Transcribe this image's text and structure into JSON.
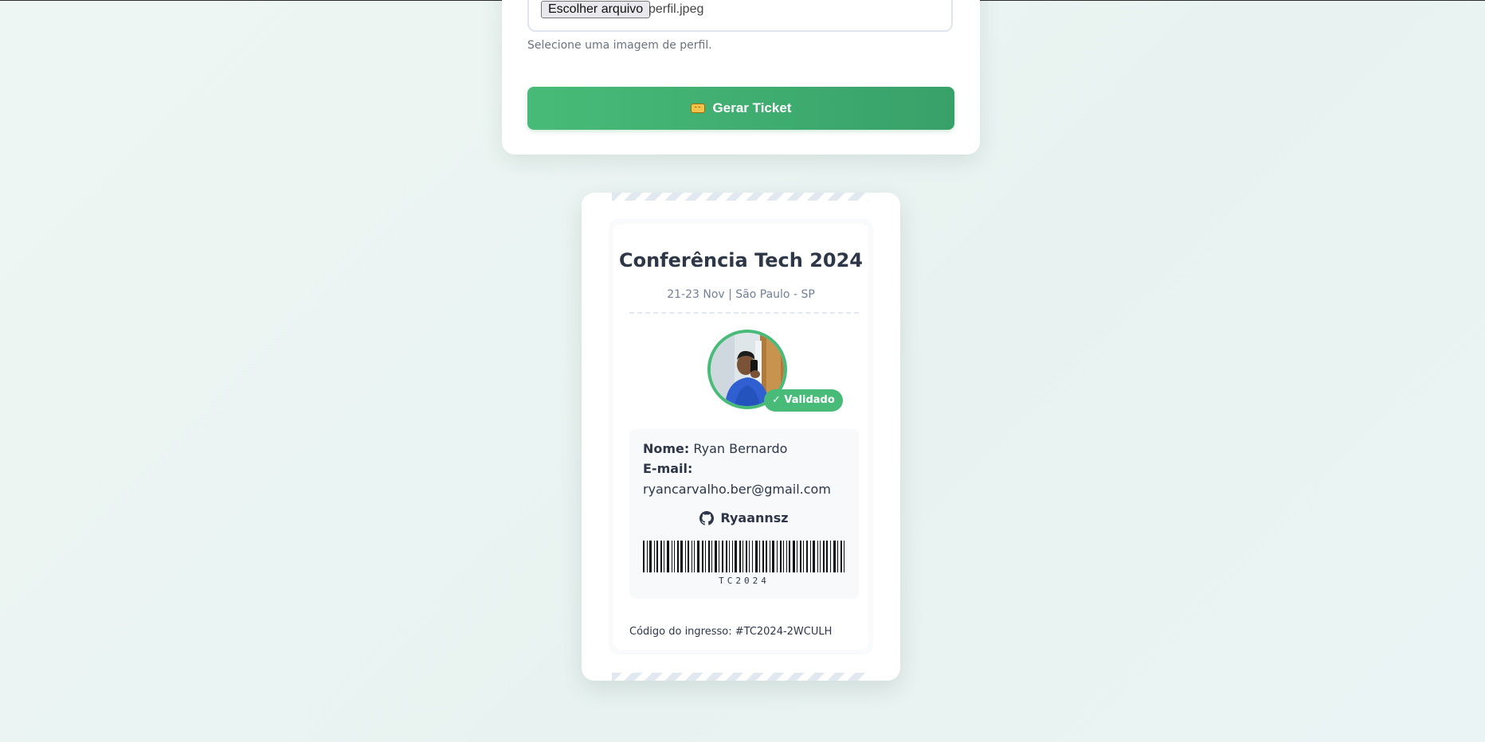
{
  "form": {
    "file_button_label": "Escolher arquivo",
    "file_name": "perfil.jpeg",
    "file_hint": "Selecione uma imagem de perfil.",
    "submit_label": "Gerar Ticket",
    "submit_icon": "ticket-icon"
  },
  "ticket": {
    "title": "Conferência Tech 2024",
    "subtitle": "21-23 Nov | São Paulo - SP",
    "badge": "✓ Validado",
    "name_label": "Nome:",
    "name_value": "Ryan Bernardo",
    "email_label": "E-mail:",
    "email_value": "ryancarvalho.ber@gmail.com",
    "github_icon": "github-icon",
    "github_user": "Ryaannsz",
    "barcode_text": "TC2024",
    "code_line": "Código do ingresso: #TC2024-2WCULH"
  },
  "colors": {
    "accent": "#48bb78",
    "accent_dark": "#38a169",
    "text": "#2d3748",
    "muted": "#718096"
  }
}
